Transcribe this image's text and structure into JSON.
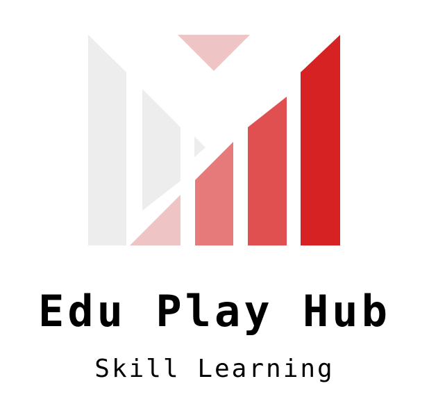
{
  "brand": {
    "title": "Edu Play Hub",
    "tagline": "Skill Learning"
  },
  "colors": {
    "background": "#ffffff",
    "gray_bars": "#ededed",
    "pale_red": "#efc4c4",
    "light_red": "#e67a7a",
    "mid_red": "#e05050",
    "red": "#d62222",
    "text": "#000000"
  },
  "icons": {
    "logo": "bar-chart-m-logo-icon"
  }
}
